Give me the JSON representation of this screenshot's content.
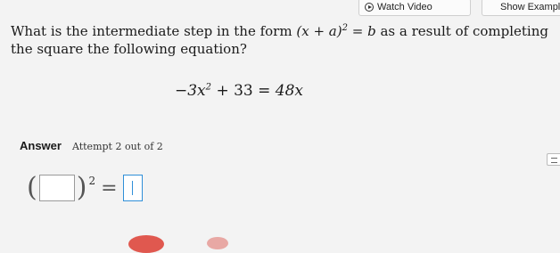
{
  "toolbar": {
    "watch_video_label": "Watch Video",
    "show_examples_label": "Show Example"
  },
  "question": {
    "text_before": "What is the intermediate step in the form",
    "form_lhs": "(x + a)",
    "form_exp": "2",
    "form_rhs": "= b",
    "text_after": "as a result of completing the square the following equation?"
  },
  "equation": {
    "lhs_coef": "−3x",
    "lhs_exp": "2",
    "lhs_rest": "+ 33",
    "equals": "=",
    "rhs": "48x"
  },
  "answer": {
    "label": "Answer",
    "attempt": "Attempt 2 out of 2",
    "open_paren": "(",
    "close_paren": ")",
    "exponent": "2",
    "equals": "="
  },
  "colors": {
    "background": "#f3f3f3",
    "active_input_border": "#2f8fd8"
  }
}
